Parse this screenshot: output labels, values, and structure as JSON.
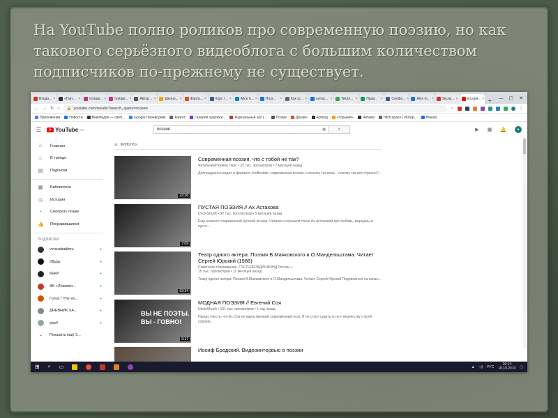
{
  "slide": {
    "title": "На YouTube полно роликов про современную поэзию, но как такового серьёзного видеоблога с большим количеством подписчиков по-прежнему не существует."
  },
  "browser": {
    "tabs": [
      {
        "label": "Входя...",
        "color": "#d93025"
      },
      {
        "label": "«Нап...",
        "color": "#333333"
      },
      {
        "label": "Instagr...",
        "color": "#c13584"
      },
      {
        "label": "Instagr...",
        "color": "#c13584"
      },
      {
        "label": "Автор...",
        "color": "#555555"
      },
      {
        "label": "Джоно...",
        "color": "#f4a300"
      },
      {
        "label": "Фарта...",
        "color": "#e44d26"
      },
      {
        "label": "Курс !...",
        "color": "#3b5998"
      },
      {
        "label": "Alice h...",
        "color": "#0088cc"
      },
      {
        "label": "Поэт...",
        "color": "#1a73e8"
      },
      {
        "label": "Как ус...",
        "color": "#666666"
      },
      {
        "label": "сигна...",
        "color": "#1a73e8"
      },
      {
        "label": "Teksti...",
        "color": "#34a853"
      },
      {
        "label": "Прав...",
        "color": "#0f9d58"
      },
      {
        "label": "Coolbo...",
        "color": "#3b5998"
      },
      {
        "label": "Alex m...",
        "color": "#1a73e8"
      },
      {
        "label": "Экспр...",
        "color": "#d93025"
      },
      {
        "label": "поэзия...",
        "color": "#ff0000"
      }
    ],
    "url": "youtube.com/results?search_query=поэзия",
    "bookmarks": [
      {
        "label": "Приложения",
        "color": "#4285f4"
      },
      {
        "label": "Новости",
        "color": "#1a73e8"
      },
      {
        "label": "Википедия — своб...",
        "color": "#333333"
      },
      {
        "label": "Google Переводчик",
        "color": "#4285f4"
      },
      {
        "label": "Азатос",
        "color": "#666666"
      },
      {
        "label": "Галерея художни...",
        "color": "#8a2be2"
      },
      {
        "label": "Журнальный зал |...",
        "color": "#c0392b"
      },
      {
        "label": "Поэма",
        "color": "#555555"
      },
      {
        "label": "Дизайн",
        "color": "#e44d26"
      },
      {
        "label": "Арткод",
        "color": "#333333"
      },
      {
        "label": "«Горький»",
        "color": "#f4a300"
      },
      {
        "label": "Читаем",
        "color": "#333333"
      },
      {
        "label": "hitch.space | Интер...",
        "color": "#666666"
      },
      {
        "label": "Никорг",
        "color": "#1a73e8"
      }
    ]
  },
  "youtube": {
    "logo_text": "YouTube",
    "logo_region": "RU",
    "search_value": "поэзия",
    "filters_label": "ФИЛЬТРЫ",
    "sidebar": {
      "main": [
        {
          "label": "Главная",
          "icon": "home-icon",
          "glyph": "⌂"
        },
        {
          "label": "В тренде",
          "icon": "trending-icon",
          "glyph": "♨"
        },
        {
          "label": "Подписки",
          "icon": "subscriptions-icon",
          "glyph": "▤"
        }
      ],
      "library": [
        {
          "label": "Библиотека",
          "icon": "library-icon",
          "glyph": "▦"
        },
        {
          "label": "История",
          "icon": "history-icon",
          "glyph": "◷"
        },
        {
          "label": "Смотреть позже",
          "icon": "watch-later-icon",
          "glyph": "◔"
        },
        {
          "label": "Понравившиеся",
          "icon": "liked-icon",
          "glyph": "👍"
        }
      ],
      "subs_heading": "ПОДПИСКИ",
      "subscriptions": [
        {
          "label": "versusbattleru",
          "color": "#333333"
        },
        {
          "label": "#Дудь",
          "color": "#111111"
        },
        {
          "label": "КЕКР",
          "color": "#222222"
        },
        {
          "label": "ФК «Локомот...",
          "color": "#c0392b"
        },
        {
          "label": "Голос / The Vo...",
          "color": "#d35400"
        },
        {
          "label": "ДНЕВНИК ХА...",
          "color": "#7f8c8d"
        },
        {
          "label": "sbp4",
          "color": "#95a5a6"
        }
      ],
      "show_more": "Показать ещё 3..."
    },
    "results": [
      {
        "title": "Современная поэзия, что с тобой не так?",
        "meta": "Читальчик/Полина Парс • 23 тыс. просмотров • 7 месяцев назад",
        "desc": "Долгожданное видео в формате #coffeetalk: современная поэзия, и почему так всра... почему так все странно?...",
        "duration": "22:38",
        "thumb_bg": "#2c2c2c",
        "thumb_caption": ""
      },
      {
        "title": "ПУСТАЯ ПОЭЗИЯ // Ах Астахова",
        "meta": "UncleShurik • 32 тыс. просмотров • 5 месяцев назад",
        "desc": "Еще немного современной русской поэзии. Читаем и слушаем стихи Ах Астаховой про любовь, морщины и пусто...",
        "duration": "7:09",
        "thumb_bg": "#1a1a1a",
        "thumb_caption": ""
      },
      {
        "title": "Театр одного актера. Поэзия В.Маяковского и О.Мандельштама. Читает Сергей Юрский (1988)",
        "meta": "Советское телевидение. ГОСТЕЛЕРАДИОФОНД России ✓",
        "meta2": "15 тыс. просмотров • 11 месяцев назад",
        "desc": "Театр одного актера. Поэзия В.Маяковского и О.Мандельштама. Читает Сергей Юрский Подписаться на канал...",
        "duration": "53:34",
        "thumb_bg": "#3a3a3a",
        "thumb_caption": ""
      },
      {
        "title": "МОДНАЯ ПОЭЗИЯ // Евгений Соя",
        "meta": "UncleShurik • 101 тыс. просмотров • 1 год назад",
        "desc": "Прошу учесть, что Ес Соя не единственный современный поэт. И не стоит судить по его творчеству о всей соврем...",
        "duration": "9:17",
        "thumb_bg": "#222222",
        "thumb_caption": "ВЫ НЕ ПОЭТЫ. ВЫ - ГОВНО!"
      },
      {
        "title": "Иосиф Бродский. Видеоинтервью о поэзии",
        "meta": "",
        "desc": "",
        "duration": "",
        "thumb_bg": "#5a4a3a",
        "thumb_caption": ""
      }
    ]
  },
  "taskbar": {
    "lang": "РУС",
    "time": "16:14",
    "date": "18.10.2019"
  }
}
